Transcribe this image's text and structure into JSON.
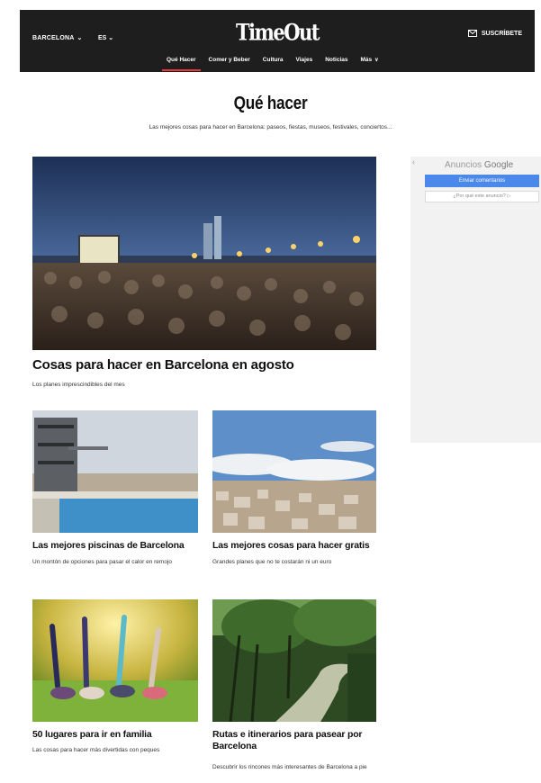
{
  "header": {
    "city": "BARCELONA",
    "language": "ES",
    "logo": "TimeOut",
    "subscribe": "SUSCRÍBETE",
    "nav": [
      {
        "label": "Qué Hacer",
        "active": true
      },
      {
        "label": "Comer y Beber"
      },
      {
        "label": "Cultura"
      },
      {
        "label": "Viajes"
      },
      {
        "label": "Noticias"
      },
      {
        "label": "Más"
      }
    ]
  },
  "page": {
    "title": "Qué hacer",
    "subtitle": "Las mejores cosas para hacer en Barcelona: paseos, fiestas, museos, festivales, conciertos..."
  },
  "featured": {
    "title": "Cosas para hacer en Barcelona en agosto",
    "description": "Los planes imprescindibles del mes"
  },
  "cards": [
    {
      "title": "Las mejores piscinas de Barcelona",
      "description": "Un montón de opciones para pasar el calor en remojo"
    },
    {
      "title": "Las mejores cosas para hacer gratis",
      "description": "Grandes planes que no te costarán ni un euro"
    },
    {
      "title": "50 lugares para ir en familia",
      "description": "Las cosas para hacer más divertidas con peques"
    },
    {
      "title": "Rutas e itinerarios para pasear por Barcelona",
      "description": "Descubrir los rincones más interesantes de Barcelona a pie"
    }
  ],
  "ad": {
    "label_prefix": "Anuncios",
    "label_brand": "Google",
    "feedback_button": "Enviar comentarios",
    "why_link": "¿Por qué este anuncio? ▷"
  },
  "colors": {
    "header_bg": "#1e1e1e",
    "nav_active": "#e23a3a",
    "ad_button": "#4a88ea"
  }
}
